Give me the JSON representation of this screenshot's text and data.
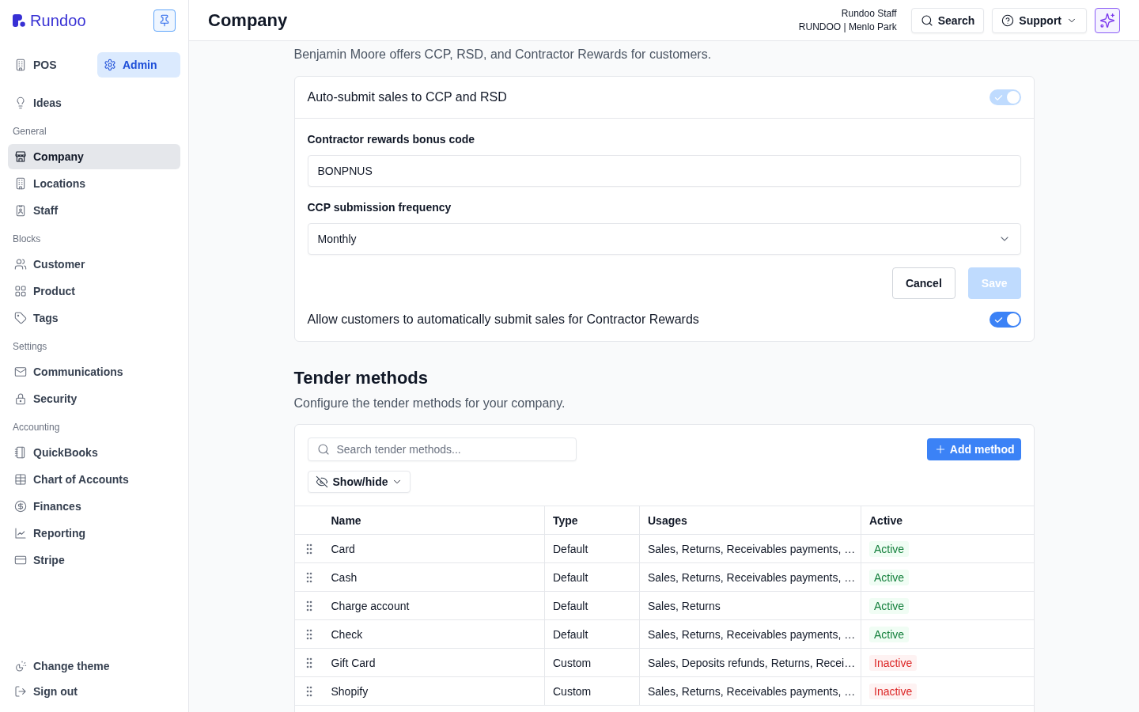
{
  "sidebar": {
    "logo": "Rundoo",
    "modes": [
      {
        "label": "POS",
        "selected": false
      },
      {
        "label": "Admin",
        "selected": true
      }
    ],
    "sections": [
      {
        "items": [
          {
            "label": "Ideas",
            "selected": false
          }
        ]
      },
      {
        "heading": "General",
        "items": [
          {
            "label": "Company",
            "selected": true
          },
          {
            "label": "Locations",
            "selected": false
          },
          {
            "label": "Staff",
            "selected": false
          }
        ]
      },
      {
        "heading": "Blocks",
        "items": [
          {
            "label": "Customer",
            "selected": false
          },
          {
            "label": "Product",
            "selected": false
          },
          {
            "label": "Tags",
            "selected": false
          }
        ]
      },
      {
        "heading": "Settings",
        "items": [
          {
            "label": "Communications",
            "selected": false
          },
          {
            "label": "Security",
            "selected": false
          }
        ]
      },
      {
        "heading": "Accounting",
        "items": [
          {
            "label": "QuickBooks",
            "selected": false
          },
          {
            "label": "Chart of Accounts",
            "selected": false
          },
          {
            "label": "Finances",
            "selected": false
          },
          {
            "label": "Reporting",
            "selected": false
          },
          {
            "label": "Stripe",
            "selected": false
          }
        ]
      }
    ],
    "footer_items": [
      {
        "label": "Change theme"
      },
      {
        "label": "Sign out"
      }
    ]
  },
  "header": {
    "title": "Company",
    "user": {
      "name": "Rundoo Staff",
      "org": "RUNDOO | Menlo Park"
    },
    "search_button": "Search",
    "support_menu": "Support"
  },
  "intro": "Benjamin Moore offers CCP, RSD, and Contractor Rewards for customers.",
  "settings_card": {
    "auto_submit": {
      "label": "Auto-submit sales to CCP and RSD",
      "on": true,
      "disabled": true
    },
    "fields": [
      {
        "kind": "text",
        "label": "Contractor rewards bonus code",
        "value": "BONPNUS"
      },
      {
        "kind": "select",
        "label": "CCP submission frequency",
        "value": "Monthly"
      }
    ],
    "actions": [
      {
        "kind": "secondary",
        "label": "Cancel",
        "disabled": false
      },
      {
        "kind": "primary",
        "label": "Save",
        "disabled": true
      }
    ],
    "contractor_rewards": {
      "label": "Allow customers to automatically submit sales for Contractor Rewards",
      "on": true,
      "disabled": false
    }
  },
  "tender_methods": {
    "title": "Tender methods",
    "description": "Configure the tender methods for your company.",
    "search": {
      "placeholder": "Search tender methods..."
    },
    "add_button": "Add method",
    "show_hide_button": "Show/hide",
    "table": {
      "columns": [
        "Name",
        "Type",
        "Usages",
        "Active"
      ],
      "rows": [
        {
          "name": "Card",
          "type": "Default",
          "usages": "Sales, Returns, Receivables payments, …",
          "status": "Active",
          "active": true
        },
        {
          "name": "Cash",
          "type": "Default",
          "usages": "Sales, Returns, Receivables payments, …",
          "status": "Active",
          "active": true
        },
        {
          "name": "Charge account",
          "type": "Default",
          "usages": "Sales, Returns",
          "status": "Active",
          "active": true
        },
        {
          "name": "Check",
          "type": "Default",
          "usages": "Sales, Returns, Receivables payments, …",
          "status": "Active",
          "active": true
        },
        {
          "name": "Gift Card",
          "type": "Custom",
          "usages": "Sales, Deposits refunds, Returns, Recei…",
          "status": "Inactive",
          "active": false
        },
        {
          "name": "Shopify",
          "type": "Custom",
          "usages": "Sales, Returns, Receivables payments, …",
          "status": "Inactive",
          "active": false
        }
      ]
    }
  }
}
